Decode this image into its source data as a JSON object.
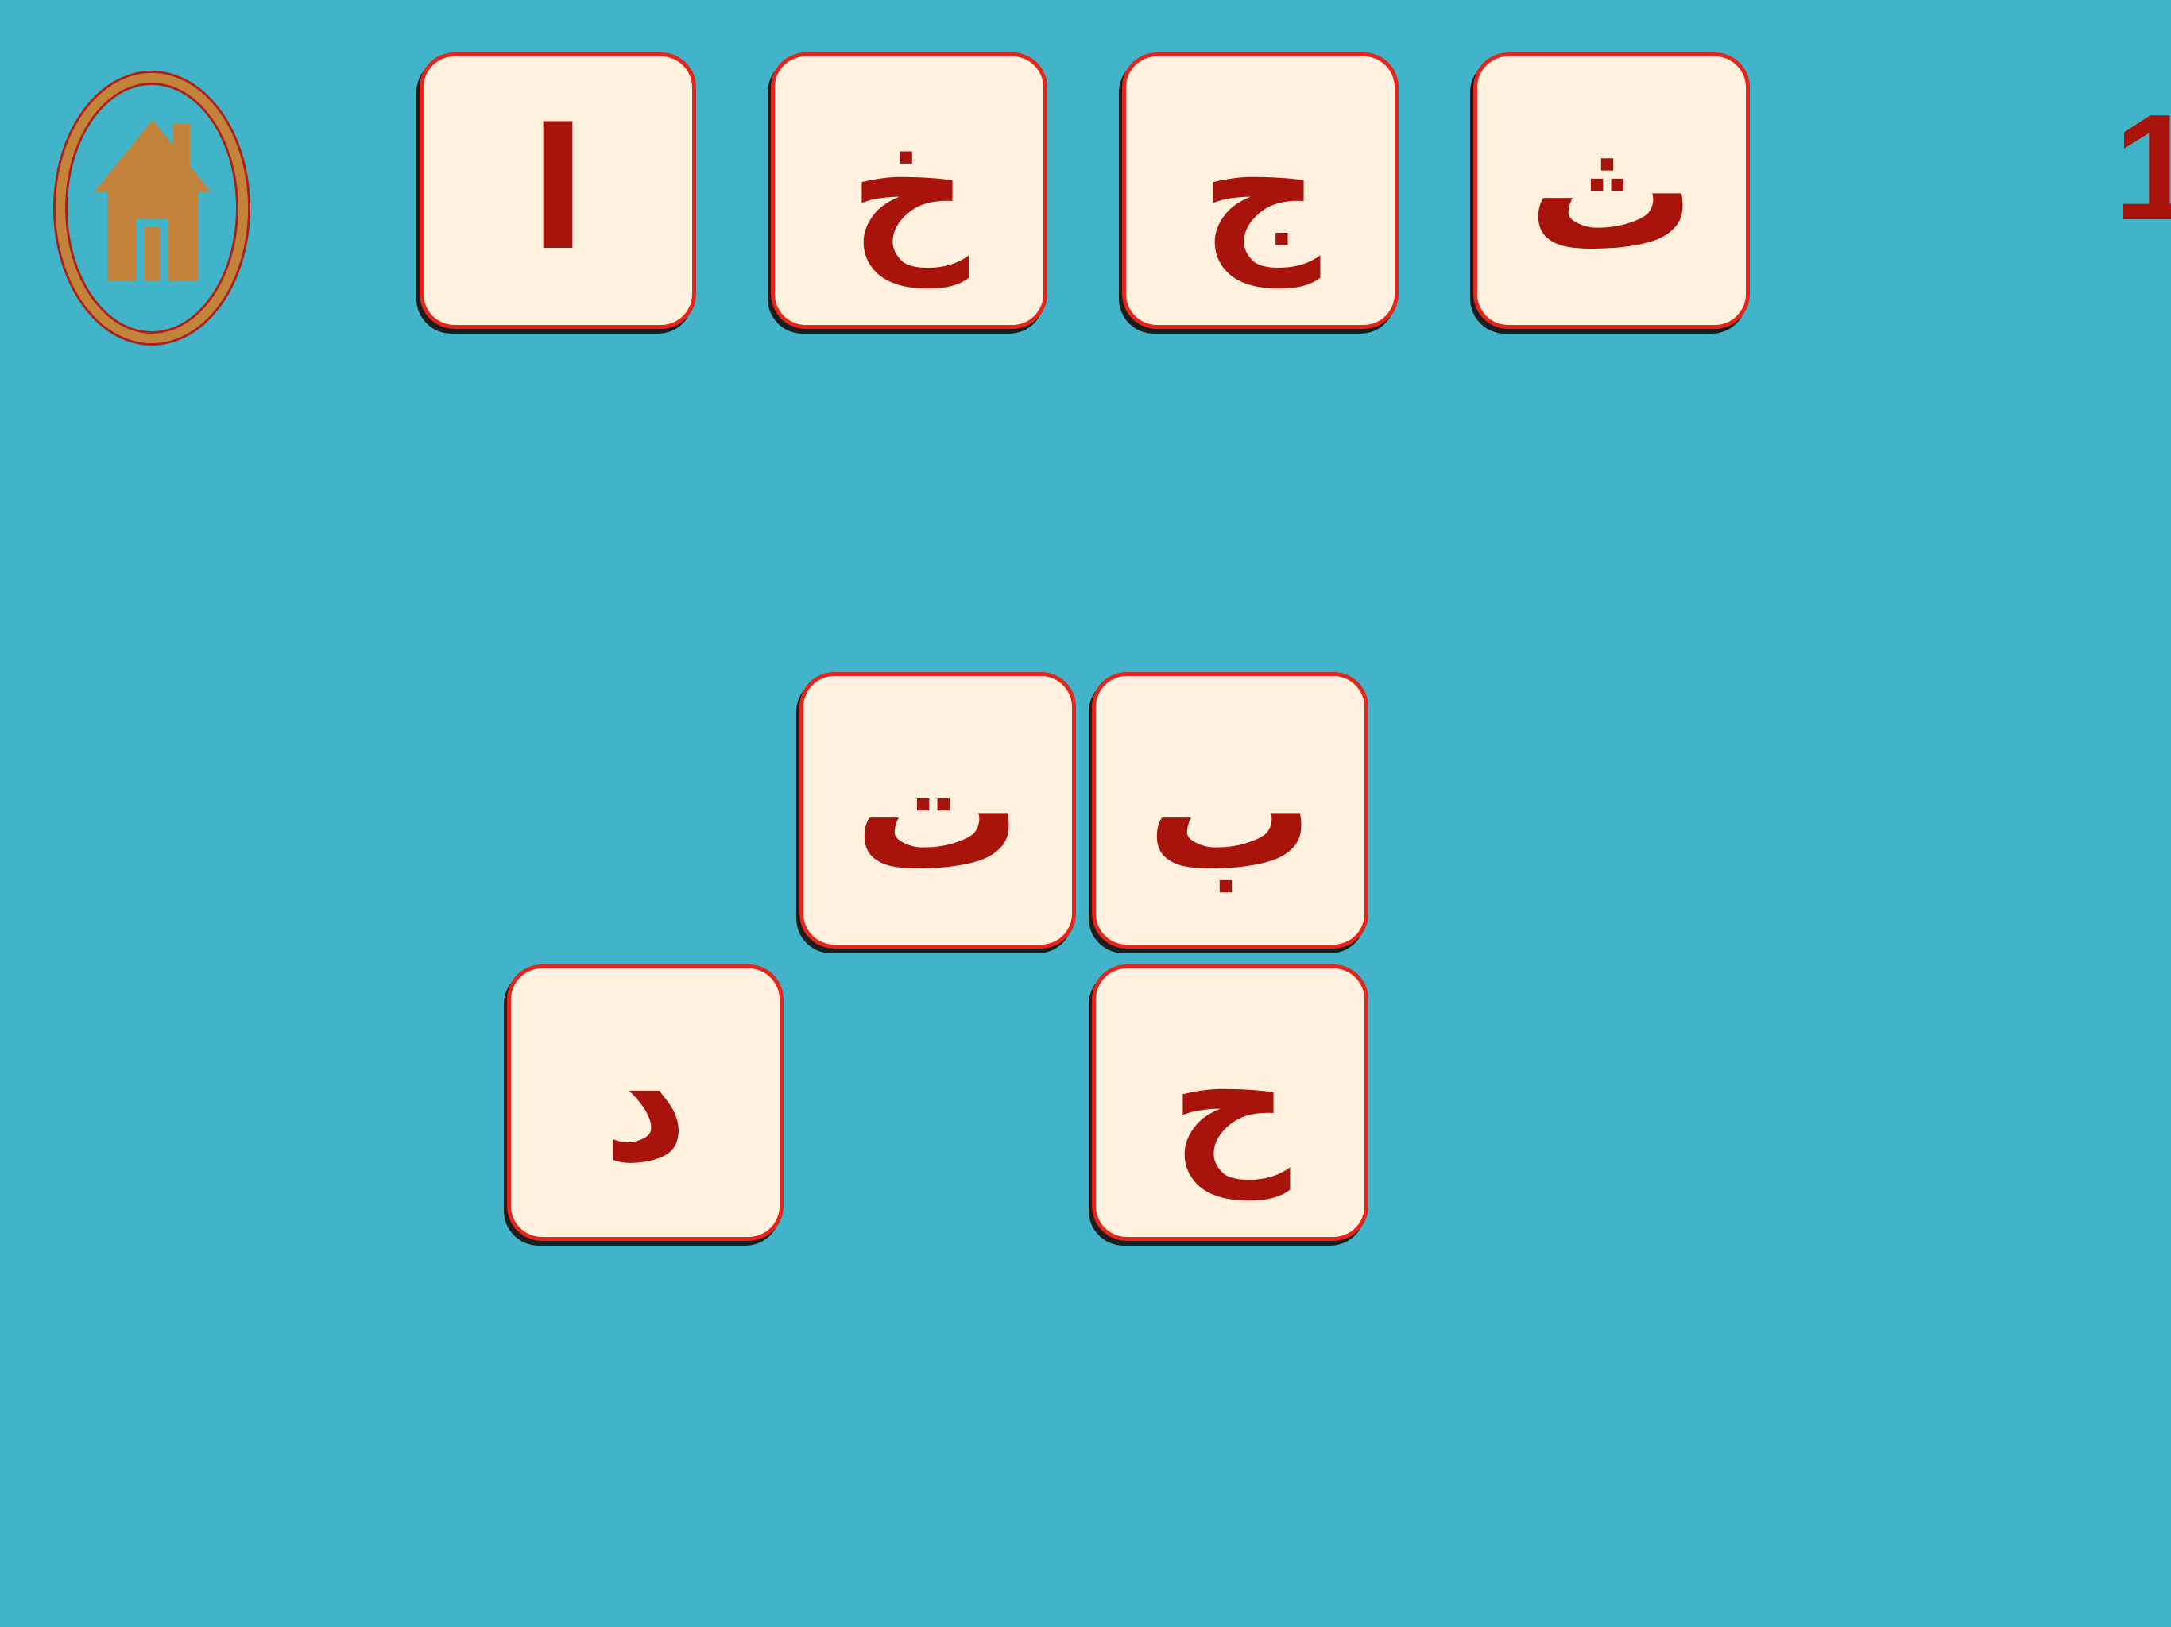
{
  "home": {
    "icon": "home-icon"
  },
  "counter": "1",
  "top_row": [
    {
      "letter": "ا"
    },
    {
      "letter": "خ"
    },
    {
      "letter": "ج"
    },
    {
      "letter": "ث"
    }
  ],
  "board": [
    {
      "letter": "ت"
    },
    {
      "letter": "ب"
    },
    {
      "letter": "د"
    },
    {
      "letter": "ح"
    }
  ],
  "colors": {
    "background": "#42b4c9",
    "tile_fill": "#fff1dd",
    "tile_border": "#e5241b",
    "letter": "#a8140c",
    "home_icon": "#c4833a"
  }
}
